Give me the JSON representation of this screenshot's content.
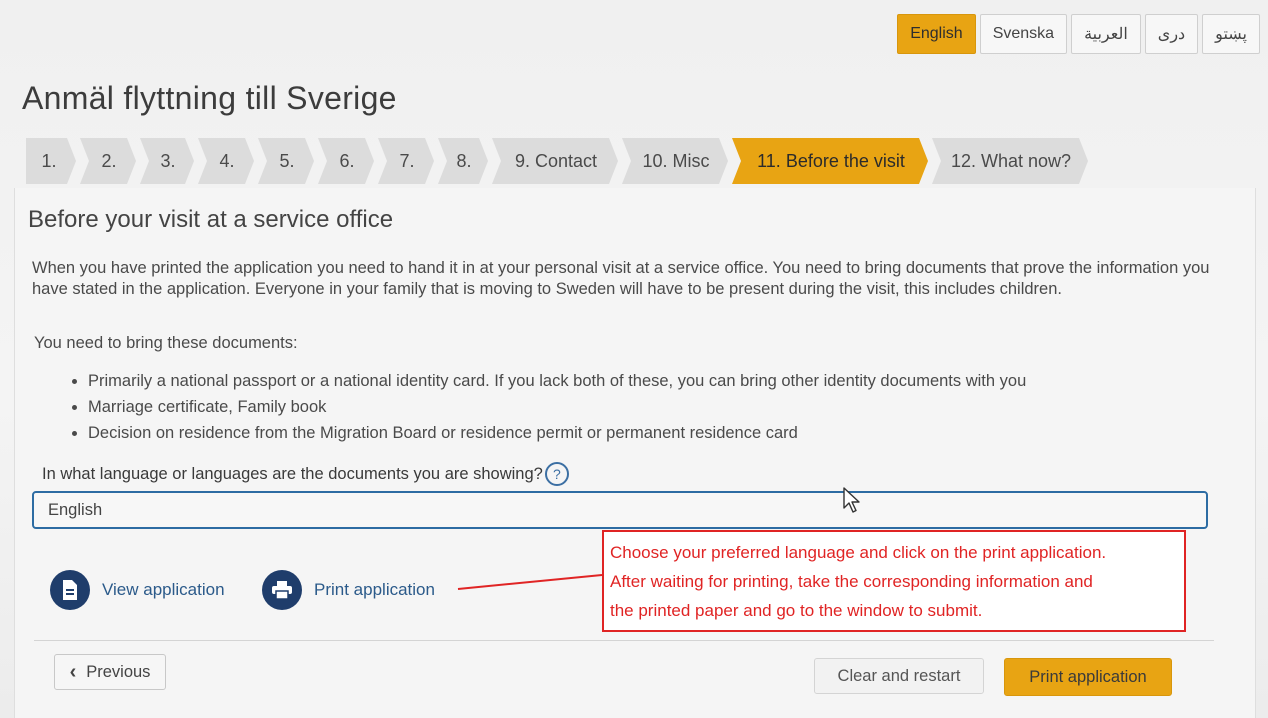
{
  "languages": [
    "English",
    "Svenska",
    "العربية",
    "دری",
    "پښتو"
  ],
  "active_language": "English",
  "page_title": "Anmäl flyttning till Sverige",
  "steps": [
    "1.",
    "2.",
    "3.",
    "4.",
    "5.",
    "6.",
    "7.",
    "8.",
    "9. Contact",
    "10. Misc",
    "11. Before the visit",
    "12. What now?"
  ],
  "active_step": "11. Before the visit",
  "section": {
    "title": "Before your visit at a service office",
    "intro": "When you have printed the application you need to hand it in at your personal visit at a service office. You need to bring documents that prove the information you have stated in the application. Everyone in your family that is moving to Sweden will have to be present during the visit, this includes children.",
    "bring_label": "You need to bring these documents:",
    "documents": [
      "Primarily a national passport or a national identity card. If you lack both of these, you can bring other identity documents with you",
      "Marriage certificate, Family book",
      "Decision on residence from the Migration Board or residence permit or permanent residence card"
    ]
  },
  "language_question": {
    "label": "In what language or languages are the documents you are showing?",
    "help": "?",
    "value": "English"
  },
  "actions": {
    "view_label": "View application",
    "print_label": "Print application"
  },
  "annotation": {
    "line1": "Choose your preferred language and click on the print application.",
    "line2": "After waiting for printing, take the corresponding information and",
    "line3": "the printed paper and go to the window to submit."
  },
  "footer": {
    "previous_label": "Previous",
    "previous_icon": "‹",
    "clear_label": "Clear and restart",
    "print_label": "Print application"
  },
  "colors": {
    "accent": "#e8a413",
    "step_inactive": "#dcdcdc",
    "icon_navy": "#1f3d6b",
    "input_border": "#2d6ca3",
    "annotation_red": "#e02424"
  }
}
